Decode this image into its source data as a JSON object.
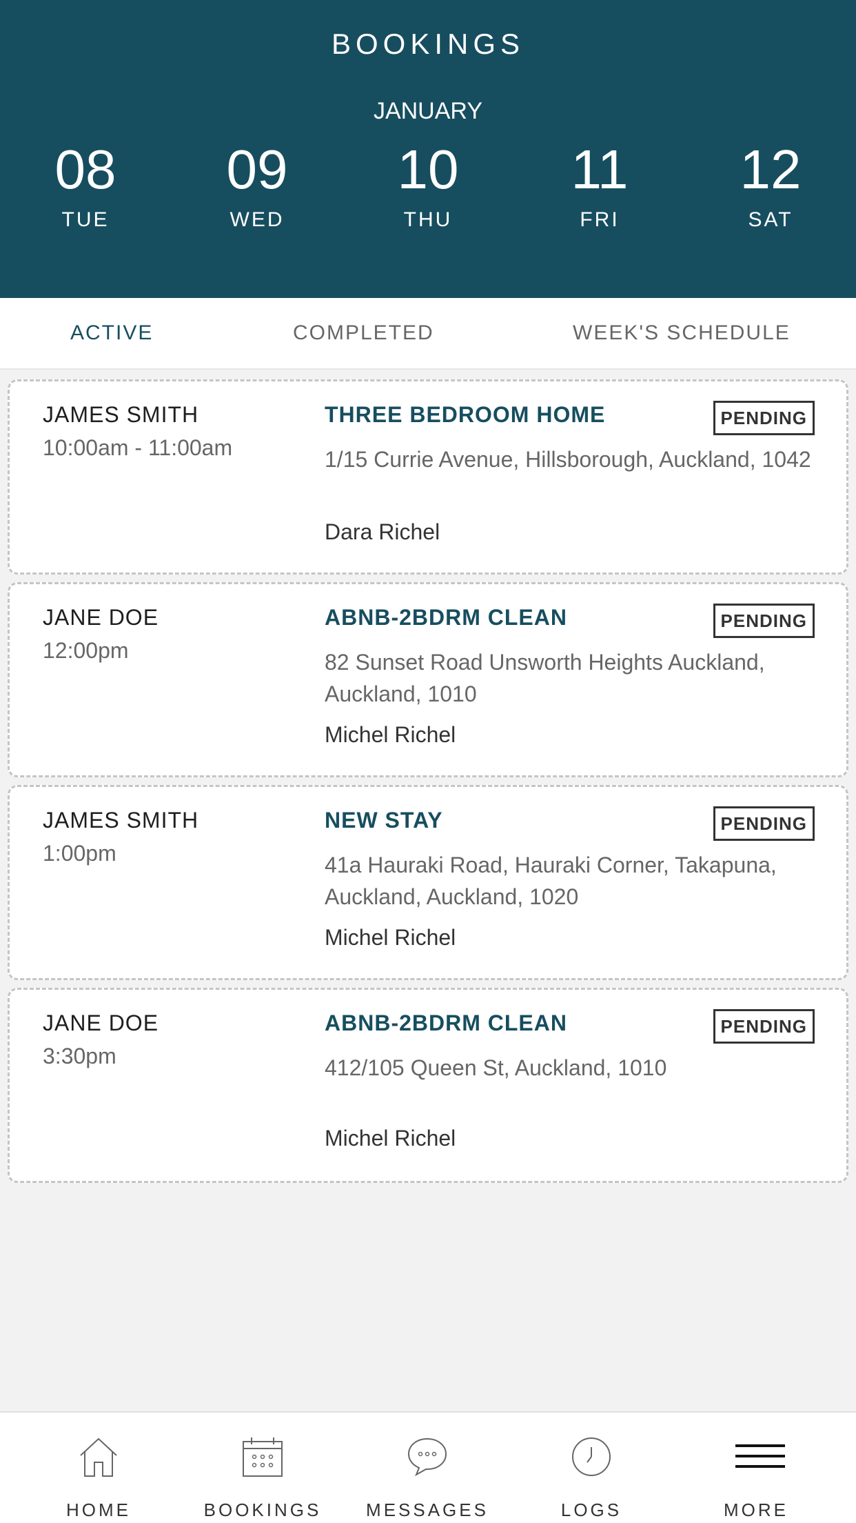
{
  "header": {
    "title": "BOOKINGS",
    "month": "JANUARY",
    "days": [
      {
        "num": "08",
        "dow": "TUE"
      },
      {
        "num": "09",
        "dow": "WED"
      },
      {
        "num": "10",
        "dow": "THU"
      },
      {
        "num": "11",
        "dow": "FRI"
      },
      {
        "num": "12",
        "dow": "SAT"
      }
    ]
  },
  "tabs": {
    "active": "ACTIVE",
    "completed": "COMPLETED",
    "schedule": "WEEK'S SCHEDULE"
  },
  "bookings": [
    {
      "client": "JAMES SMITH",
      "time": "10:00am - 11:00am",
      "service": "THREE BEDROOM HOME",
      "address": "1/15 Currie Avenue, Hillsborough, Auckland, 1042",
      "staff": "Dara  Richel",
      "status": "PENDING"
    },
    {
      "client": "JANE DOE",
      "time": "12:00pm",
      "service": "ABNB-2BDRM CLEAN",
      "address": "82 Sunset Road Unsworth Heights Auckland, Auckland, 1010",
      "staff": "Michel  Richel",
      "status": "PENDING"
    },
    {
      "client": "JAMES SMITH",
      "time": "1:00pm",
      "service": "NEW STAY",
      "address": "41a Hauraki Road, Hauraki Corner, Takapuna, Auckland, Auckland, 1020",
      "staff": "Michel  Richel",
      "status": "PENDING"
    },
    {
      "client": "JANE DOE",
      "time": "3:30pm",
      "service": "ABNB-2BDRM CLEAN",
      "address": "412/105 Queen St, Auckland, 1010",
      "staff": "Michel  Richel",
      "status": "PENDING"
    }
  ],
  "nav": {
    "home": {
      "label": "HOME",
      "icon": "home-icon"
    },
    "bookings": {
      "label": "BOOKINGS",
      "icon": "calendar-icon"
    },
    "messages": {
      "label": "MESSAGES",
      "icon": "chat-bubble-icon"
    },
    "logs": {
      "label": "LOGS",
      "icon": "clock-icon"
    },
    "more": {
      "label": "MORE",
      "icon": "hamburger-menu-icon"
    }
  },
  "colors": {
    "brand": "#174e5f",
    "background": "#f2f2f2"
  }
}
